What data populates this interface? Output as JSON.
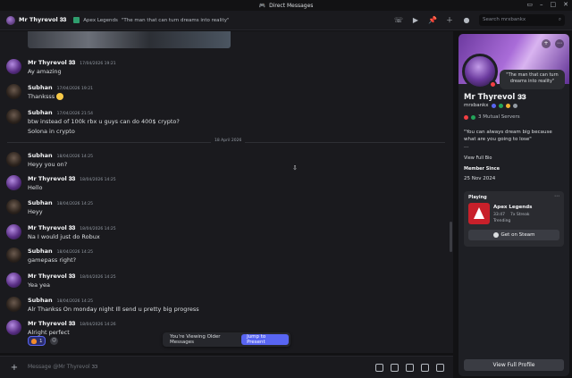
{
  "window": {
    "title": "Direct Messages"
  },
  "header": {
    "name": "Mr Thyrevol 𝟑𝟑",
    "game": "Apex Legends",
    "status": "\"The man that can turn dreams into reality\"",
    "search_placeholder": "Search mrxbankx"
  },
  "divider": {
    "date": "18 April 2026"
  },
  "messages": [
    {
      "author": "Mr Thyrevol 𝟑𝟑",
      "time": "17/04/2026 19:21",
      "lines": [
        "Ay amazing"
      ]
    },
    {
      "author": "Subhan",
      "time": "17/04/2026 19:21",
      "lines": [
        "Thanksss"
      ]
    },
    {
      "author": "Subhan",
      "time": "17/04/2026 21:54",
      "lines": [
        "btw instead of 100k rbx u guys can do 400$ crypto?",
        "Solona in crypto"
      ]
    },
    {
      "author": "Subhan",
      "time": "18/04/2026 14:25",
      "lines": [
        "Heyy you on?"
      ]
    },
    {
      "author": "Mr Thyrevol 𝟑𝟑",
      "time": "18/04/2026 14:25",
      "lines": [
        "Hello"
      ]
    },
    {
      "author": "Subhan",
      "time": "18/04/2026 14:25",
      "lines": [
        "Heyy"
      ]
    },
    {
      "author": "Mr Thyrevol 𝟑𝟑",
      "time": "18/04/2026 14:25",
      "lines": [
        "Na I would just do Robux"
      ]
    },
    {
      "author": "Subhan",
      "time": "18/04/2026 14:25",
      "lines": [
        "gamepass right?"
      ]
    },
    {
      "author": "Mr Thyrevol 𝟑𝟑",
      "time": "18/04/2026 14:25",
      "lines": [
        "Yea yea"
      ]
    },
    {
      "author": "Subhan",
      "time": "18/04/2026 14:25",
      "lines": [
        "Alr Thankss On monday night Ill send u pretty big progress"
      ]
    },
    {
      "author": "Mr Thyrevol 𝟑𝟑",
      "time": "18/04/2026 14:26",
      "lines": [
        "Alright perfect"
      ]
    }
  ],
  "reaction": {
    "count": "1"
  },
  "older_bar": {
    "label": "You're Viewing Older Messages",
    "jump": "Jump to Present"
  },
  "composer": {
    "placeholder": "Message @Mr Thyrevol 𝟑𝟑"
  },
  "profile": {
    "name": "Mr Thyrevol 𝟑𝟑",
    "username": "mrxbankx",
    "custom_status": "\"The man that can turn dreams into reality\"",
    "mutual": "3 Mutual Servers",
    "bio": "\"You can always dream big because what are you going to lose\"",
    "bio_more": "...",
    "view_full_bio": "View Full Bio",
    "member_since_label": "Member Since",
    "member_since": "25 Nov 2024",
    "playing_label": "Playing",
    "game_name": "Apex Legends",
    "game_time": "33:47",
    "game_streak": "7x Streak",
    "game_trend": "Trending",
    "steam_button": "Get on Steam",
    "full_profile_button": "View Full Profile"
  }
}
